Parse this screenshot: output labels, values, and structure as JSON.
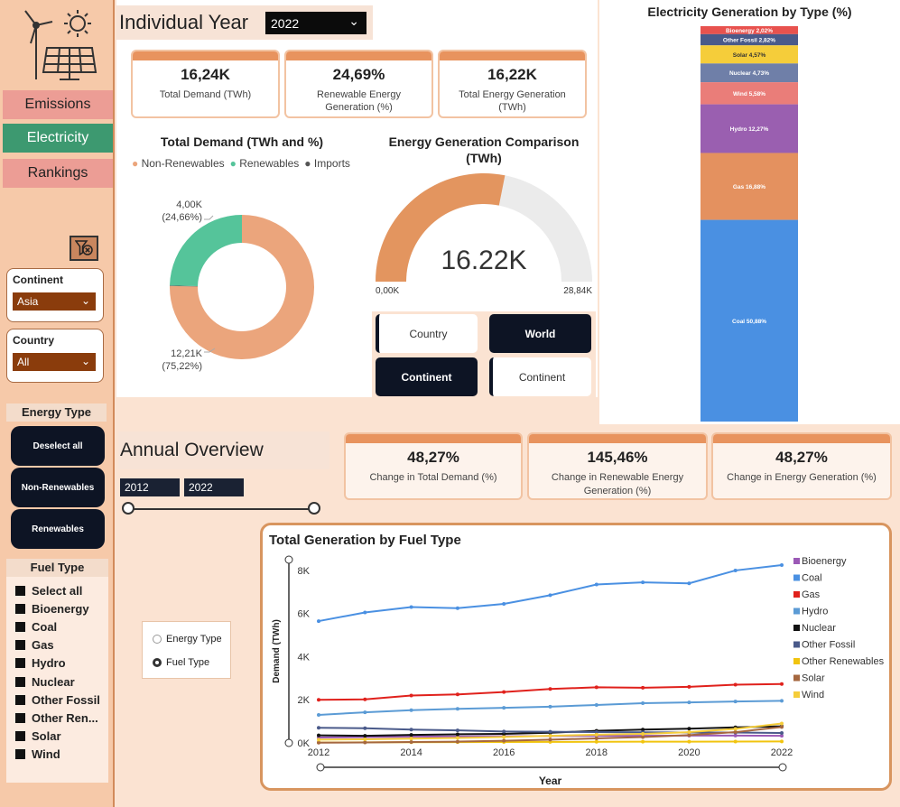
{
  "sidebar": {
    "nav": [
      "Emissions",
      "Electricity",
      "Rankings"
    ],
    "continent": {
      "label": "Continent",
      "value": "Asia"
    },
    "country": {
      "label": "Country",
      "value": "All"
    },
    "energy_type": {
      "title": "Energy Type",
      "buttons": [
        "Deselect all",
        "Non-Renewables",
        "Renewables"
      ]
    },
    "fuel_type": {
      "title": "Fuel Type",
      "items": [
        "Select all",
        "Bioenergy",
        "Coal",
        "Gas",
        "Hydro",
        "Nuclear",
        "Other Fossil",
        "Other Ren...",
        "Solar",
        "Wind"
      ]
    }
  },
  "header": {
    "title": "Individual Year",
    "year": "2022"
  },
  "kpis": [
    {
      "value": "16,24K",
      "caption": "Total Demand (TWh)"
    },
    {
      "value": "24,69%",
      "caption": "Renewable Energy Generation (%)"
    },
    {
      "value": "16,22K",
      "caption": "Total Energy Generation (TWh)"
    }
  ],
  "donut": {
    "title": "Total Demand (TWh and %)",
    "legend": [
      "Non-Renewables",
      "Renewables",
      "Imports"
    ],
    "colors": {
      "nonrenewables": "#eba57c",
      "renewables": "#55c49a",
      "imports": "#555555"
    },
    "label_renew": [
      "4,00K",
      "(24,66%)"
    ],
    "label_nonrenew": [
      "12,21K",
      "(75,22%)"
    ],
    "values": {
      "renewables": 24.66,
      "nonrenewables": 75.22,
      "imports": 0.12
    }
  },
  "gauge": {
    "title": "Energy Generation Comparison (TWh)",
    "value": "16.22K",
    "min": "0,00K",
    "max": "28,84K",
    "fraction": 0.5625
  },
  "toggles": [
    "Country",
    "World",
    "Continent",
    "Continent"
  ],
  "stacked": {
    "title": "Electricity Generation by Type (%)",
    "segments": [
      {
        "label": "Bioenergy 2,02%",
        "value": 2.02,
        "color": "#e8524e"
      },
      {
        "label": "Other Fossil 2,82%",
        "value": 2.82,
        "color": "#4a5a8a"
      },
      {
        "label": "Solar 4,57%",
        "value": 4.57,
        "color": "#f5cd3a"
      },
      {
        "label": "Nuclear 4,73%",
        "value": 4.73,
        "color": "#6f7fa8"
      },
      {
        "label": "Wind 5,58%",
        "value": 5.58,
        "color": "#ea7d79"
      },
      {
        "label": "Hydro 12,27%",
        "value": 12.27,
        "color": "#9a5fb0"
      },
      {
        "label": "Gas 16,88%",
        "value": 16.88,
        "color": "#e4915f"
      },
      {
        "label": "Coal 50,88%",
        "value": 50.88,
        "color": "#4a90e2"
      }
    ]
  },
  "annual": {
    "title": "Annual Overview",
    "range": [
      "2012",
      "2022"
    ],
    "kpis": [
      {
        "value": "48,27%",
        "caption": "Change in Total Demand (%)"
      },
      {
        "value": "145,46%",
        "caption": "Change in Renewable Energy Generation (%)"
      },
      {
        "value": "48,27%",
        "caption": "Change in Energy Generation (%)"
      }
    ],
    "radio": {
      "options": [
        "Energy Type",
        "Fuel Type"
      ],
      "selected": "Fuel Type"
    }
  },
  "chart_data": {
    "type": "line",
    "title": "Total Generation by Fuel Type",
    "xlabel": "Year",
    "ylabel": "Demand (TWh)",
    "x": [
      2012,
      2013,
      2014,
      2015,
      2016,
      2017,
      2018,
      2019,
      2020,
      2021,
      2022
    ],
    "x_ticks": [
      "2012",
      "2014",
      "2016",
      "2018",
      "2020",
      "2022"
    ],
    "y_ticks": [
      "0K",
      "2K",
      "4K",
      "6K",
      "8K"
    ],
    "ylim": [
      0,
      8500
    ],
    "legend_position": "right",
    "series": [
      {
        "name": "Bioenergy",
        "color": "#9b59b6",
        "values": [
          250,
          270,
          290,
          300,
          310,
          320,
          330,
          330,
          340,
          340,
          330
        ]
      },
      {
        "name": "Coal",
        "color": "#4a90e2",
        "values": [
          5650,
          6050,
          6300,
          6250,
          6450,
          6850,
          7350,
          7450,
          7400,
          8000,
          8250
        ]
      },
      {
        "name": "Gas",
        "color": "#e0211c",
        "values": [
          2000,
          2020,
          2200,
          2250,
          2360,
          2500,
          2580,
          2560,
          2600,
          2700,
          2730
        ]
      },
      {
        "name": "Hydro",
        "color": "#5b9bd5",
        "values": [
          1300,
          1420,
          1520,
          1580,
          1630,
          1680,
          1760,
          1840,
          1880,
          1920,
          1950
        ]
      },
      {
        "name": "Nuclear",
        "color": "#111111",
        "values": [
          350,
          330,
          370,
          400,
          420,
          470,
          560,
          620,
          660,
          720,
          770
        ]
      },
      {
        "name": "Other Fossil",
        "color": "#4a5a8a",
        "values": [
          700,
          680,
          620,
          580,
          530,
          520,
          500,
          490,
          480,
          480,
          460
        ]
      },
      {
        "name": "Other Renewables",
        "color": "#f1c40f",
        "values": [
          20,
          25,
          30,
          35,
          40,
          45,
          50,
          55,
          60,
          65,
          70
        ]
      },
      {
        "name": "Solar",
        "color": "#a5673f",
        "values": [
          10,
          20,
          40,
          60,
          100,
          150,
          210,
          270,
          360,
          500,
          740
        ]
      },
      {
        "name": "Wind",
        "color": "#f5cd3a",
        "values": [
          150,
          170,
          200,
          230,
          270,
          330,
          380,
          420,
          500,
          650,
          900
        ]
      }
    ]
  }
}
